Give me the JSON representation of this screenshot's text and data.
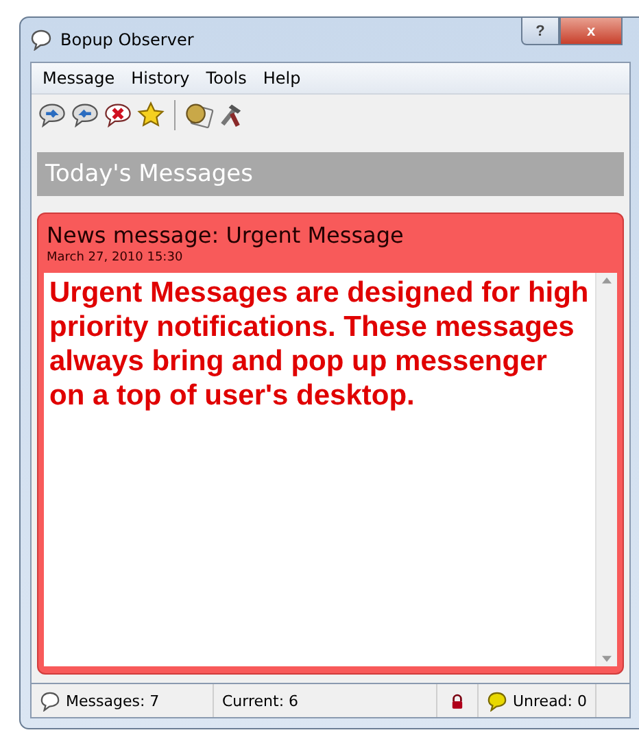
{
  "window": {
    "title": "Bopup Observer",
    "buttons": [
      "?",
      "x"
    ]
  },
  "menu": [
    "Message",
    "History",
    "Tools",
    "Help"
  ],
  "section_title": "Today's Messages",
  "message": {
    "title": "News message: Urgent Message",
    "date": "March 27, 2010 15:30",
    "body": "Urgent Messages are designed for high priority notifications. These messages always bring and pop up messenger on a top of user's desktop."
  },
  "status_bar": {
    "messages": "Messages: 7",
    "current": "Current: 6",
    "unread": "Unread: 0"
  }
}
